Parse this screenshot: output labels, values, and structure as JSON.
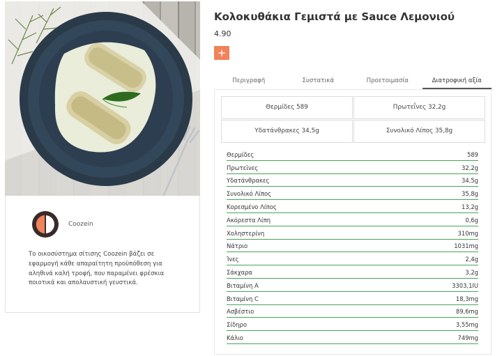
{
  "product": {
    "title": "Κολοκυθάκια Γεμιστά με Sauce Λεμονιού",
    "price": "4.90",
    "add_label": "+"
  },
  "brand": {
    "name": "Coozein",
    "description": "Το οικοσύστημα σίτισης Coozein βάζει σε εφαρμογή κάθε απαραίτητη προϋπόθεση για αληθινά καλή τροφή, που παραμένει φρέσκια ποιοτικά και απολαυστική γευστικά.",
    "logo_colors": {
      "ring": "#3a2a2a",
      "fill": "#f0835a"
    }
  },
  "tabs": [
    {
      "label": "Περιγραφή",
      "active": false
    },
    {
      "label": "Συστατικά",
      "active": false
    },
    {
      "label": "Προετοιμασία",
      "active": false
    },
    {
      "label": "Διατροφική αξία",
      "active": true
    }
  ],
  "summary": [
    "Θερμίδες 589",
    "Πρωτεΐνες 32,2g",
    "Υδατάνθρακες 34,5g",
    "Συνολικό Λίπος 35,8g"
  ],
  "nutrition": [
    {
      "name": "Θερμίδες",
      "value": "589"
    },
    {
      "name": "Πρωτεϊνες",
      "value": "32,2g"
    },
    {
      "name": "Υδατάνθρακες",
      "value": "34,5g"
    },
    {
      "name": "Συνολικό Λίπος",
      "value": "35,8g"
    },
    {
      "name": "Κορεσμένο Λίπος",
      "value": "13,2g"
    },
    {
      "name": "Ακόρεστα Λίπη",
      "value": "0,6g"
    },
    {
      "name": "Χοληστερίνη",
      "value": "310mg"
    },
    {
      "name": "Νάτριο",
      "value": "1031mg"
    },
    {
      "name": "Ίνες",
      "value": "2,4g"
    },
    {
      "name": "Σάκχαρα",
      "value": "3,2g"
    },
    {
      "name": "Βιταμίνη A",
      "value": "3303,1IU"
    },
    {
      "name": "Βιταμίνη C",
      "value": "18,3mg"
    },
    {
      "name": "Ασβέστιο",
      "value": "89,6mg"
    },
    {
      "name": "Σίδηρο",
      "value": "3,55mg"
    },
    {
      "name": "Κάλιο",
      "value": "749mg"
    }
  ],
  "colors": {
    "accent": "#f0835a",
    "row_rule": "#49a35a"
  }
}
